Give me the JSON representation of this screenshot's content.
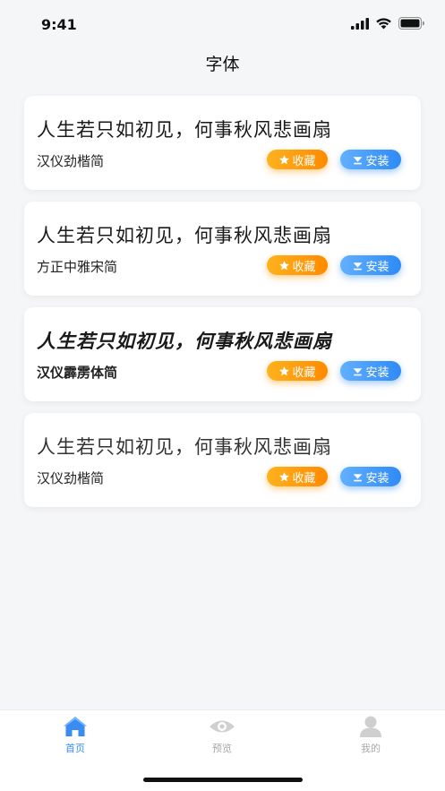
{
  "status_bar": {
    "time": "9:41"
  },
  "nav": {
    "title": "字体"
  },
  "fonts": [
    {
      "sample": "人生若只如初见，何事秋风悲画扇",
      "name": "汉仪劲楷简",
      "favorite_label": "收藏",
      "install_label": "安装"
    },
    {
      "sample": "人生若只如初见，何事秋风悲画扇",
      "name": "方正中雅宋简",
      "favorite_label": "收藏",
      "install_label": "安装"
    },
    {
      "sample": "人生若只如初见，何事秋风悲画扇",
      "name": "汉仪霹雳体简",
      "favorite_label": "收藏",
      "install_label": "安装"
    },
    {
      "sample": "人生若只如初见，何事秋风悲画扇",
      "name": "汉仪劲楷简",
      "favorite_label": "收藏",
      "install_label": "安装"
    }
  ],
  "tabbar": {
    "tabs": [
      {
        "label": "首页",
        "icon": "home-icon",
        "active": true
      },
      {
        "label": "预览",
        "icon": "eye-icon",
        "active": false
      },
      {
        "label": "我的",
        "icon": "user-icon",
        "active": false
      }
    ]
  },
  "colors": {
    "accent": "#3b8cf0",
    "favorite": "#ff9a0a",
    "install": "#3d93f7",
    "inactive": "#c4c4c4"
  }
}
